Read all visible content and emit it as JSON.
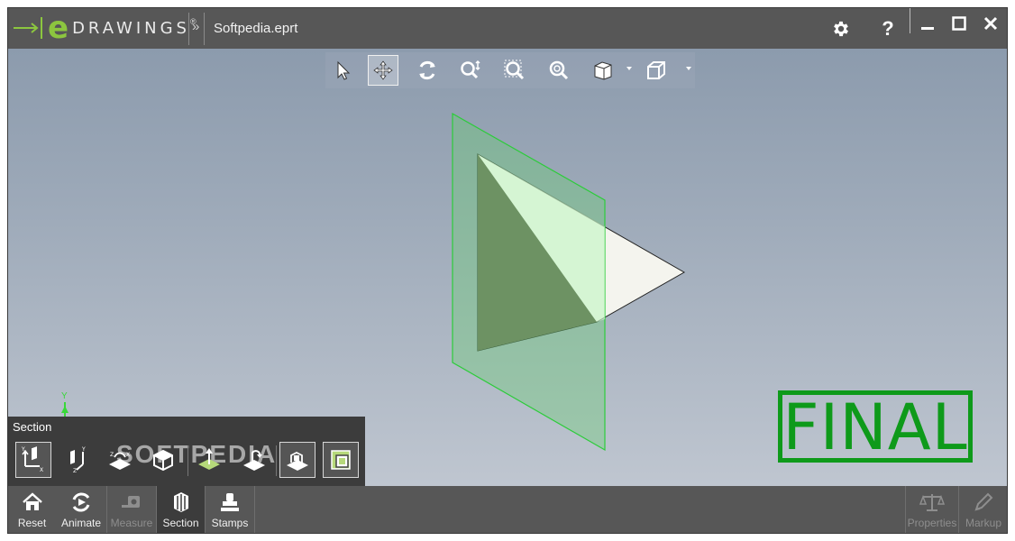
{
  "app": {
    "logo_letter": "e",
    "logo_word": "DRAWINGS",
    "logo_mark": "®",
    "chevron": "»",
    "filename": "Softpedia.eprt"
  },
  "title_buttons": {
    "settings_icon": "gear-icon",
    "help_label": "?",
    "minimize_icon": "minimize-icon",
    "maximize_icon": "maximize-icon",
    "close_icon": "close-icon"
  },
  "view_tools": [
    "select-arrow-icon",
    "pan-icon",
    "rotate-icon",
    "zoom-icon",
    "zoom-to-area-icon",
    "zoom-to-fit-icon",
    "views-cube-icon",
    "display-style-icon"
  ],
  "triad": {
    "axis_y": "Y"
  },
  "stamp": {
    "text": "FINAL",
    "color": "#0e9a1a"
  },
  "section_panel": {
    "title": "Section",
    "watermark": "SOFTPEDIA"
  },
  "bottom_bar": {
    "reset": "Reset",
    "animate": "Animate",
    "measure": "Measure",
    "section": "Section",
    "stamps": "Stamps",
    "properties": "Properties",
    "markup": "Markup"
  },
  "colors": {
    "accent": "#8cc63f",
    "section_plane": "#3fd24b",
    "toolbar": "#575757"
  }
}
